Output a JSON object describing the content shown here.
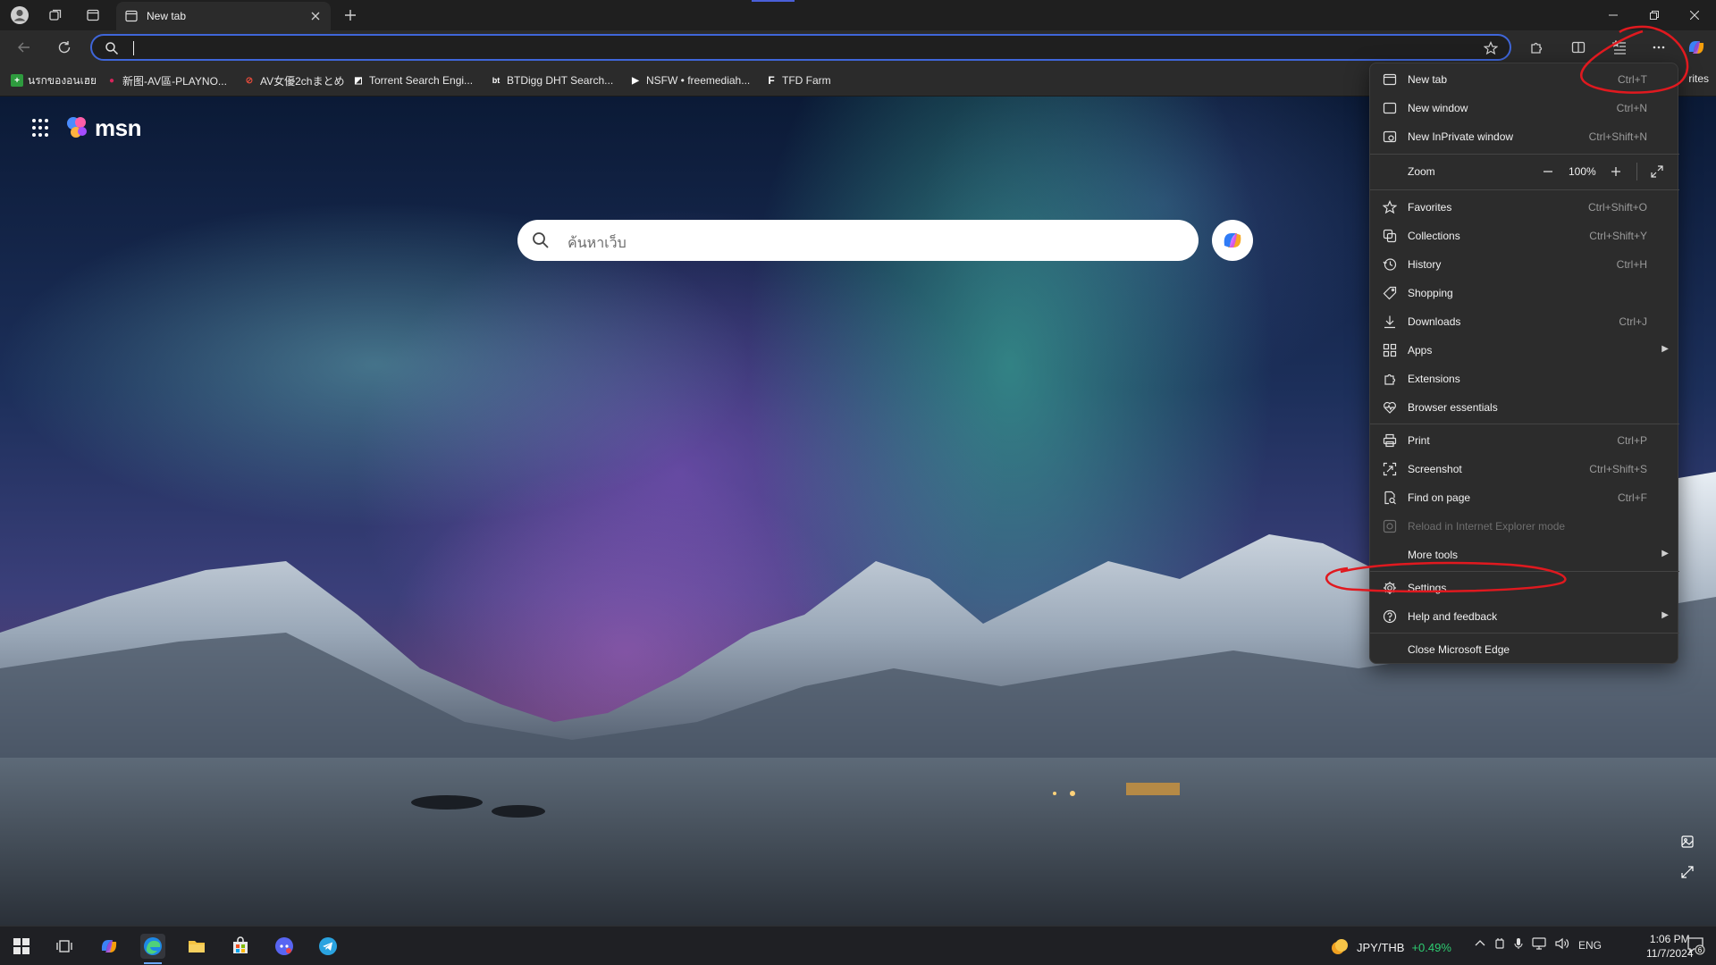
{
  "browser": {
    "tab": {
      "title": "New tab"
    },
    "address": {
      "value": ""
    },
    "bookmarks": [
      {
        "label": "นรกของอนเฮย",
        "fav_color": "#2e9b3e",
        "fav_glyph": "+"
      },
      {
        "label": "新图-AV區-PLAYNO...",
        "fav_color": "#d6245a",
        "fav_glyph": "●"
      },
      {
        "label": "AV女優2chまとめ",
        "fav_color": "#c0392b",
        "fav_glyph": "⊘"
      },
      {
        "label": "Torrent Search Engi...",
        "fav_color": "#ffffff",
        "fav_glyph": "◩"
      },
      {
        "label": "BTDigg DHT Search...",
        "fav_color": "#2b2b2b",
        "fav_glyph": "bt"
      },
      {
        "label": "NSFW • freemediah...",
        "fav_color": "#2b2b2b",
        "fav_glyph": "▶"
      },
      {
        "label": "TFD Farm",
        "fav_color": "#2b2b2b",
        "fav_glyph": "F"
      }
    ],
    "bookmarks_overflow": "rites",
    "colors": {
      "accent": "#3f66d9",
      "annotation": "#e0191f"
    }
  },
  "msn": {
    "brand": "msn",
    "search_placeholder": "ค้นหาเว็บ"
  },
  "menu": {
    "items": [
      {
        "label": "New tab",
        "shortcut": "Ctrl+T",
        "icon": "new-tab-icon"
      },
      {
        "label": "New window",
        "shortcut": "Ctrl+N",
        "icon": "window-icon"
      },
      {
        "label": "New InPrivate window",
        "shortcut": "Ctrl+Shift+N",
        "icon": "inprivate-icon"
      },
      {
        "label": "Zoom",
        "value": "100%",
        "icon": ""
      },
      {
        "label": "Favorites",
        "shortcut": "Ctrl+Shift+O",
        "icon": "star-icon"
      },
      {
        "label": "Collections",
        "shortcut": "Ctrl+Shift+Y",
        "icon": "collections-icon"
      },
      {
        "label": "History",
        "shortcut": "Ctrl+H",
        "icon": "history-icon"
      },
      {
        "label": "Shopping",
        "shortcut": "",
        "icon": "tag-icon"
      },
      {
        "label": "Downloads",
        "shortcut": "Ctrl+J",
        "icon": "download-icon"
      },
      {
        "label": "Apps",
        "shortcut": "",
        "icon": "apps-icon"
      },
      {
        "label": "Extensions",
        "shortcut": "",
        "icon": "puzzle-icon"
      },
      {
        "label": "Browser essentials",
        "shortcut": "",
        "icon": "heart-pulse-icon"
      },
      {
        "label": "Print",
        "shortcut": "Ctrl+P",
        "icon": "printer-icon"
      },
      {
        "label": "Screenshot",
        "shortcut": "Ctrl+Shift+S",
        "icon": "screenshot-icon"
      },
      {
        "label": "Find on page",
        "shortcut": "Ctrl+F",
        "icon": "find-icon"
      },
      {
        "label": "Reload in Internet Explorer mode",
        "shortcut": "",
        "icon": "ie-icon",
        "disabled": true
      },
      {
        "label": "More tools",
        "shortcut": "",
        "icon": ""
      },
      {
        "label": "Settings",
        "shortcut": "",
        "icon": "gear-icon"
      },
      {
        "label": "Help and feedback",
        "shortcut": "",
        "icon": "help-icon"
      },
      {
        "label": "Close Microsoft Edge",
        "shortcut": "",
        "icon": ""
      }
    ]
  },
  "taskbar": {
    "ticker_pair": "JPY/THB",
    "ticker_change": "+0.49%",
    "language": "ENG",
    "time": "1:06 PM",
    "date": "11/7/2024",
    "notification_count": "6"
  }
}
